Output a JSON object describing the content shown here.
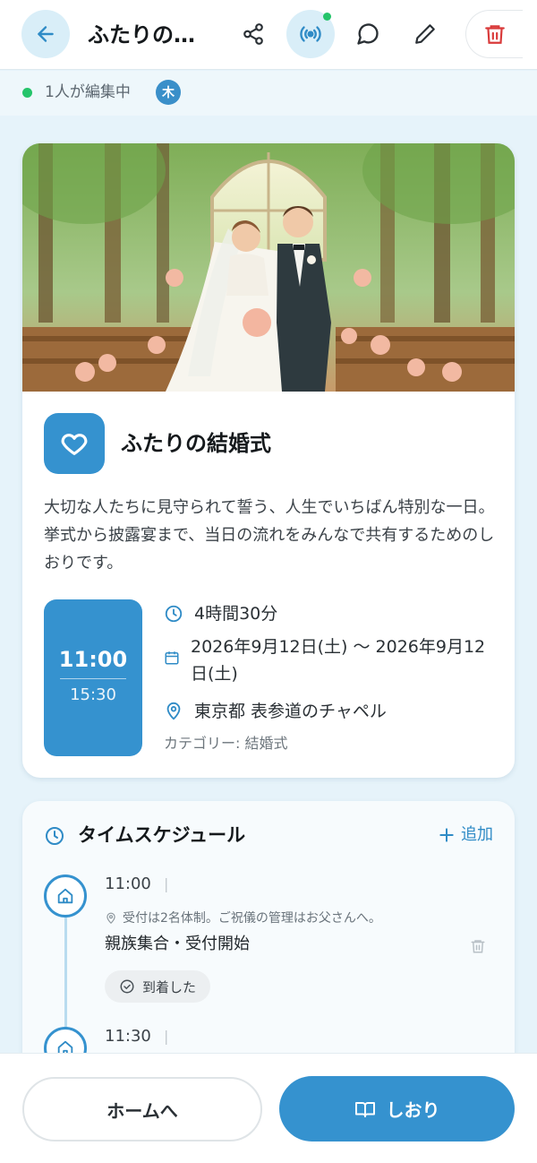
{
  "header": {
    "title": "ふたりの…",
    "icons": [
      "arrow-left-icon",
      "share-icon",
      "broadcast-icon",
      "comment-icon",
      "pencil-icon",
      "trash-icon"
    ],
    "accent_color": "#3592cf",
    "delete_color": "#d93a3a"
  },
  "presence": {
    "text": "1人が編集中",
    "avatar_initial": "木",
    "status_color": "#25c46a"
  },
  "event": {
    "title": "ふたりの結婚式",
    "description": "大切な人たちに見守られて誓う、人生でいちばん特別な一日。挙式から披露宴まで、当日の流れをみんなで共有するためのしおりです。",
    "start_time": "11:00",
    "end_time": "15:30",
    "duration": "4時間30分",
    "date": "2026年9月12日(土) 〜 2026年9月12日(土)",
    "location": "東京都 表参道のチャペル",
    "category": "カテゴリー: 結婚式"
  },
  "schedule": {
    "title": "タイムスケジュール",
    "add_label": "追加",
    "items": [
      {
        "time": "11:00",
        "note": "受付は2名体制。ご祝儀の管理はお父さんへ。",
        "name": "親族集合・受付開始",
        "status": "到着した"
      },
      {
        "time": "11:30"
      }
    ]
  },
  "bottom": {
    "home_label": "ホームへ",
    "guide_label": "しおり"
  }
}
